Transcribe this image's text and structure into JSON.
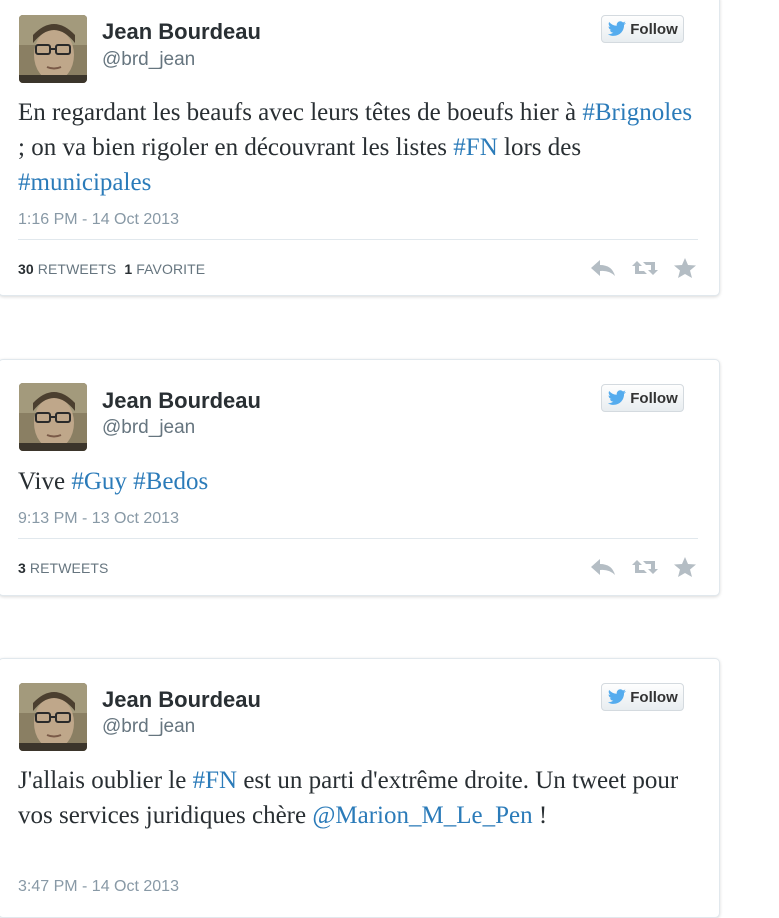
{
  "follow_label": "Follow",
  "icons": {
    "follow": "twitter-bird-icon",
    "reply": "reply-icon",
    "retweet": "retweet-icon",
    "favorite": "star-icon"
  },
  "colors": {
    "hashtag": "#2b7bb9",
    "bird": "#55acee",
    "meta": "#8899a6"
  },
  "tweets": [
    {
      "name": "Jean Bourdeau",
      "handle": "@brd_jean",
      "text_parts": [
        "En regardant les beaufs avec leurs têtes de boeufs hier à ",
        "#Brignoles",
        " ; on va bien rigoler en découvrant les listes ",
        "#FN",
        " lors des ",
        "#municipales"
      ],
      "time": "1:16 PM - 14 Oct 2013",
      "retweets_count": "30",
      "retweets_label": "RETWEETS",
      "favorites_count": "1",
      "favorites_label": "FAVORITE"
    },
    {
      "name": "Jean Bourdeau",
      "handle": "@brd_jean",
      "text_parts": [
        "Vive ",
        "#Guy",
        " ",
        "#Bedos"
      ],
      "time": "9:13 PM - 13 Oct 2013",
      "retweets_count": "3",
      "retweets_label": "RETWEETS"
    },
    {
      "name": "Jean Bourdeau",
      "handle": "@brd_jean",
      "text_parts": [
        "J'allais oublier le ",
        "#FN",
        " est un parti d'extrême droite. Un tweet pour vos services juridiques chère ",
        "@Marion_M_Le_Pen",
        " !"
      ],
      "time": "3:47 PM - 14 Oct 2013"
    }
  ]
}
